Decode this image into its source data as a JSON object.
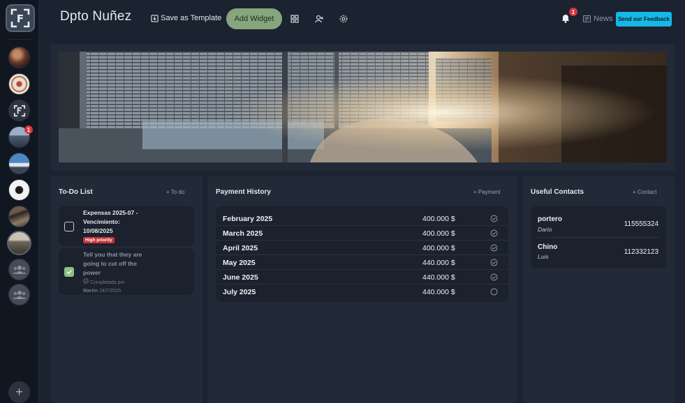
{
  "header": {
    "title": "Dpto Nuñez",
    "save_template_label": "Save as Template",
    "add_widget_label": "Add Widget",
    "notification_count": "1",
    "news_label": "News",
    "feedback_label": "Send our Feedback"
  },
  "sidebar": {
    "logo_letter": "F",
    "space_badge_count": "1",
    "add_space_label": "+"
  },
  "todo": {
    "title": "To-Do List",
    "add_label": "+ To do",
    "items": [
      {
        "lines": [
          "Expensas 2025-07 -",
          "Vencimiento:",
          "10/08/2025"
        ],
        "badge": "High priority",
        "done": false
      },
      {
        "lines": [
          "Tell you that they are",
          "going to cut off the",
          "power"
        ],
        "completed_label": "Completada por",
        "completed_by": "Martin",
        "completed_date": "24/7/2025",
        "done": true
      }
    ]
  },
  "payments": {
    "title": "Payment History",
    "add_label": "+ Payment",
    "rows": [
      {
        "month": "February 2025",
        "amount": "400.000 $",
        "paid": true
      },
      {
        "month": "March 2025",
        "amount": "400.000 $",
        "paid": true
      },
      {
        "month": "April 2025",
        "amount": "400.000 $",
        "paid": true
      },
      {
        "month": "May 2025",
        "amount": "440.000 $",
        "paid": true
      },
      {
        "month": "June 2025",
        "amount": "440.000 $",
        "paid": true
      },
      {
        "month": "July 2025",
        "amount": "440.000 $",
        "paid": false
      }
    ]
  },
  "contacts": {
    "title": "Useful Contacts",
    "add_label": "+ Contact",
    "items": [
      {
        "role": "portero",
        "name": "Dario",
        "phone": "115555324"
      },
      {
        "role": "Chino",
        "name": "Luis",
        "phone": "112332123"
      }
    ]
  },
  "colors": {
    "accent_green": "#86a67e",
    "feedback_blue": "#16b8e6",
    "badge_red": "#d9363e"
  }
}
